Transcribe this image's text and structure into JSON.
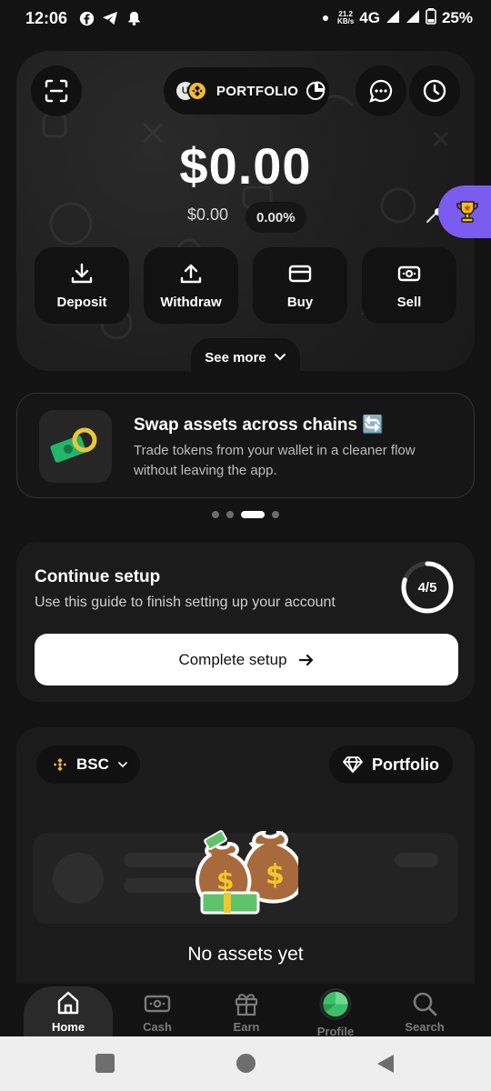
{
  "status_bar": {
    "time": "12:06",
    "speed_value": "21.2",
    "speed_unit": "KB/s",
    "network": "4G",
    "battery": "25%"
  },
  "header": {
    "portfolio_label": "PORTFOLIO",
    "coin_letter": "U"
  },
  "balance": {
    "main": "$0.00",
    "secondary": "$0.00",
    "change_pct": "0.00%"
  },
  "actions": [
    {
      "label": "Deposit",
      "icon": "download-icon"
    },
    {
      "label": "Withdraw",
      "icon": "upload-icon"
    },
    {
      "label": "Buy",
      "icon": "card-icon"
    },
    {
      "label": "Sell",
      "icon": "cash-icon"
    }
  ],
  "see_more_label": "See more",
  "banner": {
    "title": "Swap assets across chains 🔄",
    "description": "Trade tokens from your wallet in a cleaner flow without leaving the app.",
    "page_count": 4,
    "active_page": 3
  },
  "setup": {
    "title": "Continue setup",
    "description": "Use this guide to finish setting up your account",
    "progress_label": "4/5",
    "progress_fraction": 0.8,
    "button_label": "Complete setup"
  },
  "assets": {
    "chain_label": "BSC",
    "portfolio_button": "Portfolio",
    "empty_text": "No assets yet"
  },
  "bottom_nav": [
    {
      "label": "Home",
      "icon": "home-icon",
      "active": true
    },
    {
      "label": "Cash",
      "icon": "cash-icon",
      "active": false
    },
    {
      "label": "Earn",
      "icon": "gift-icon",
      "active": false
    },
    {
      "label": "Profile",
      "icon": "avatar-icon",
      "active": false
    },
    {
      "label": "Search",
      "icon": "search-icon",
      "active": false
    }
  ],
  "colors": {
    "background": "#131313",
    "accent_purple": "#7b5cf0",
    "bnb_yellow": "#f3ba2f",
    "profile_green": "#3dbf6a"
  }
}
